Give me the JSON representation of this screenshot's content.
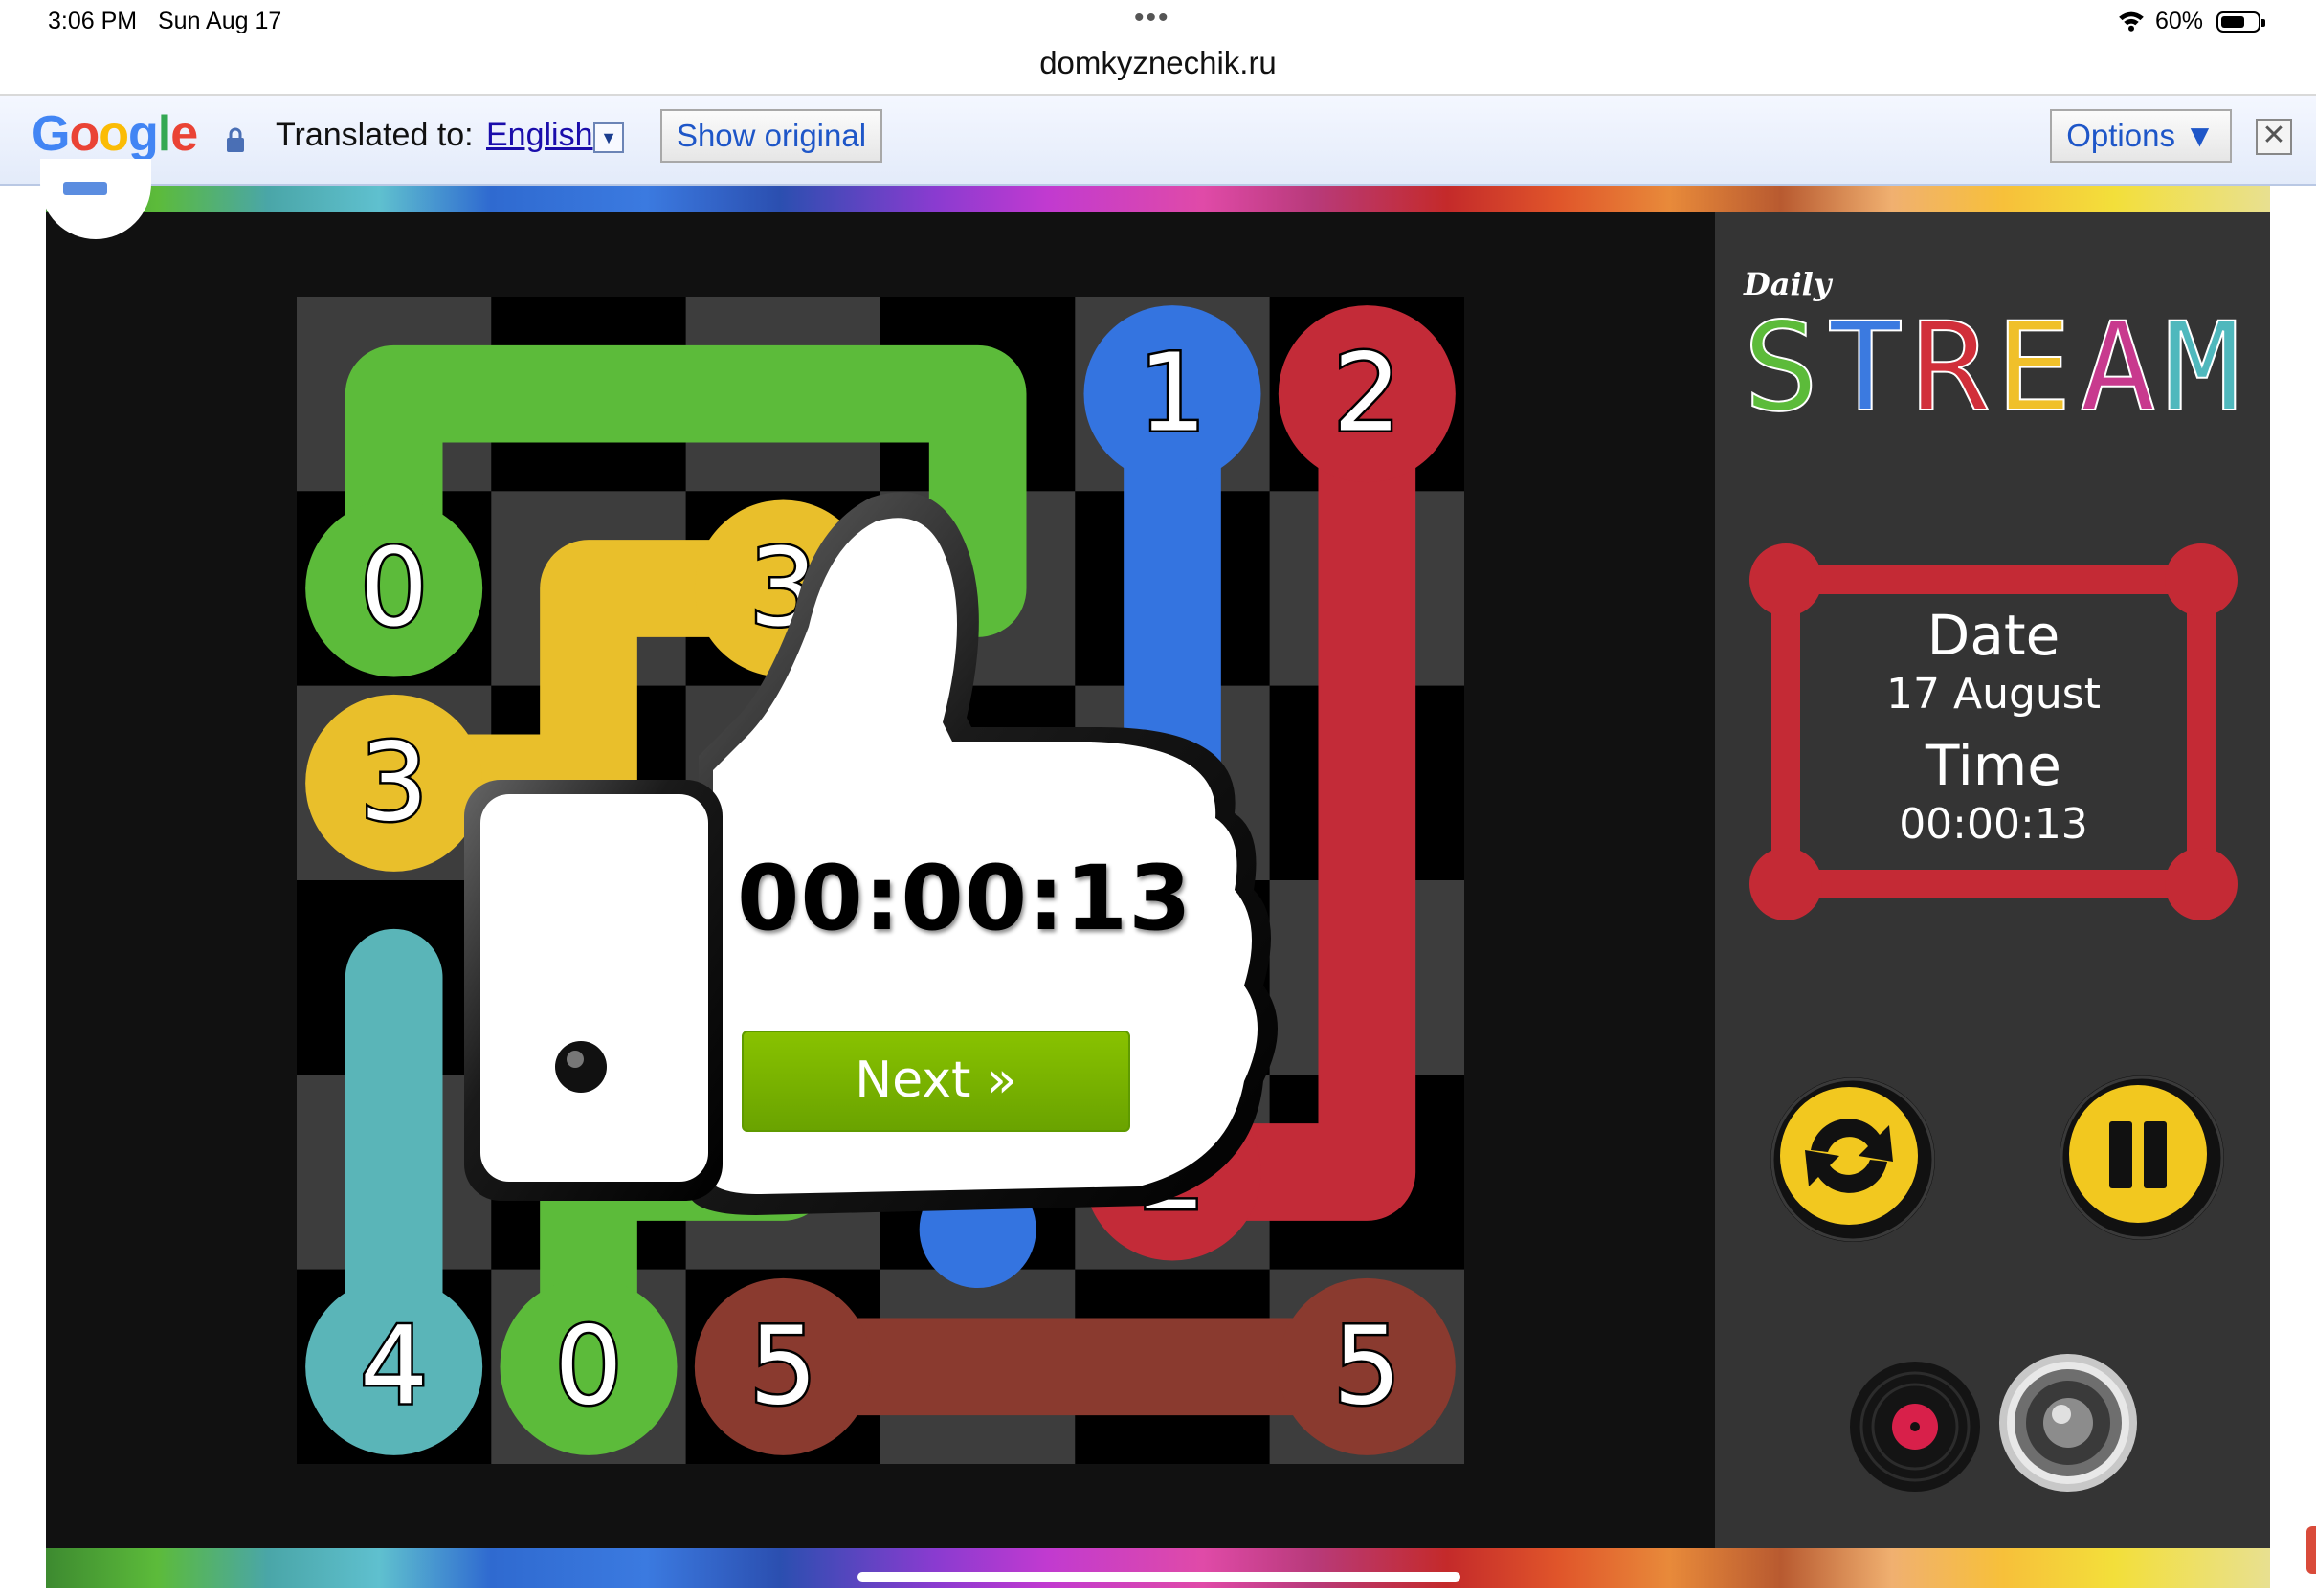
{
  "status_bar": {
    "time": "3:06 PM",
    "date": "Sun Aug 17",
    "battery": "60%",
    "dots": "•••"
  },
  "url": "domkyznechik.ru",
  "translate_bar": {
    "logo": "Google",
    "label": "Translated to:",
    "language": "English",
    "show_original": "Show original",
    "options": "Options ▼",
    "close": "✕"
  },
  "logo": {
    "small": "Daily",
    "title": "STREAM",
    "title_colors": [
      "#5cbb3a",
      "#3b7ae0",
      "#d12f3a",
      "#f0c02a",
      "#c83a8e",
      "#4fb8bd"
    ]
  },
  "info_panel": {
    "date_label": "Date",
    "date_value": "17 August",
    "time_label": "Time",
    "time_value": "00:00:13",
    "frame_color": "#c42a35"
  },
  "popup": {
    "timer": "00:00:13",
    "next_label": "Next »"
  },
  "controls": {
    "restart_icon": "restart-icon",
    "pause_icon": "pause-icon",
    "music_icon": "vinyl-record-icon",
    "sound_icon": "speaker-icon",
    "control_color": "#f2c81f"
  },
  "board": {
    "rows": 6,
    "cols": 6,
    "colors": {
      "green": "#5cbb3a",
      "yellow": "#e9bf2b",
      "blue": "#3474e0",
      "red": "#c32b38",
      "teal": "#5ab5b8",
      "brown": "#8a3a2f"
    },
    "endpoints": [
      {
        "row": 0,
        "col": 4,
        "label": "1",
        "color": "blue"
      },
      {
        "row": 0,
        "col": 5,
        "label": "2",
        "color": "red"
      },
      {
        "row": 1,
        "col": 0,
        "label": "0",
        "color": "green"
      },
      {
        "row": 1,
        "col": 2,
        "label": "3",
        "color": "yellow"
      },
      {
        "row": 2,
        "col": 0,
        "label": "3",
        "color": "yellow"
      },
      {
        "row": 4,
        "col": 4,
        "label": "2",
        "color": "red"
      },
      {
        "row": 5,
        "col": 0,
        "label": "4",
        "color": "teal"
      },
      {
        "row": 5,
        "col": 1,
        "label": "0",
        "color": "green"
      },
      {
        "row": 5,
        "col": 2,
        "label": "5",
        "color": "brown"
      },
      {
        "row": 5,
        "col": 5,
        "label": "5",
        "color": "brown"
      }
    ],
    "paths": [
      {
        "color": "green",
        "cells": [
          [
            1,
            0
          ],
          [
            0,
            0
          ],
          [
            0,
            1
          ],
          [
            0,
            2
          ],
          [
            0,
            3
          ],
          [
            1,
            3
          ]
        ]
      },
      {
        "color": "yellow",
        "cells": [
          [
            2,
            0
          ],
          [
            2,
            1
          ],
          [
            1,
            1
          ],
          [
            1,
            2
          ]
        ]
      },
      {
        "color": "blue",
        "cells": [
          [
            0,
            4
          ],
          [
            1,
            4
          ],
          [
            2,
            4
          ]
        ]
      },
      {
        "color": "red",
        "cells": [
          [
            0,
            5
          ],
          [
            1,
            5
          ],
          [
            2,
            5
          ],
          [
            3,
            5
          ],
          [
            4,
            5
          ],
          [
            4,
            4
          ]
        ]
      },
      {
        "color": "teal",
        "cells": [
          [
            5,
            0
          ],
          [
            4,
            0
          ],
          [
            3,
            0
          ]
        ]
      },
      {
        "color": "green",
        "cells": [
          [
            5,
            1
          ],
          [
            4,
            1
          ],
          [
            4,
            2
          ]
        ]
      },
      {
        "color": "blue",
        "cells": [
          [
            4,
            3
          ]
        ]
      },
      {
        "color": "brown",
        "cells": [
          [
            5,
            2
          ],
          [
            5,
            3
          ],
          [
            5,
            4
          ],
          [
            5,
            5
          ]
        ]
      }
    ]
  }
}
